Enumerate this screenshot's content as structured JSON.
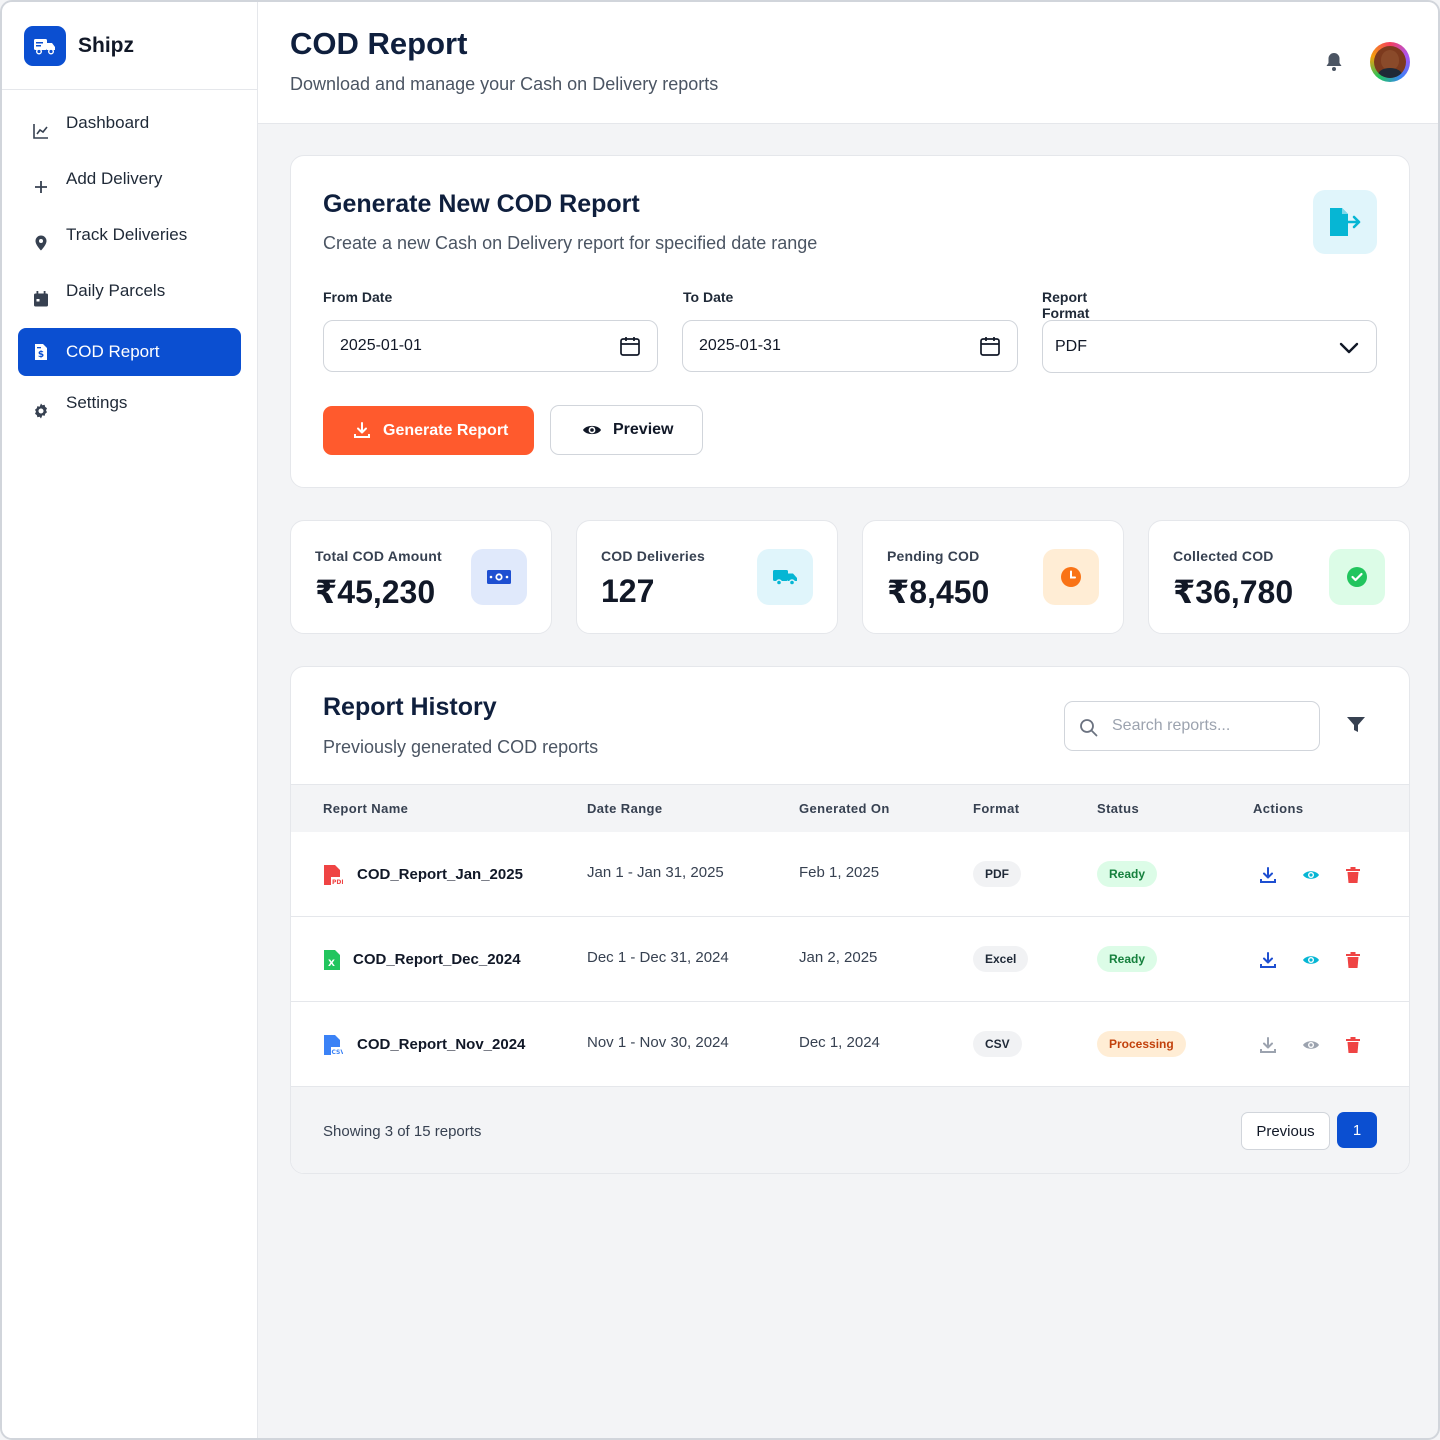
{
  "brand": {
    "name": "Shipz",
    "icon": "truck-icon"
  },
  "sidebar": {
    "items": [
      {
        "label": "Dashboard",
        "icon": "chart-line-icon"
      },
      {
        "label": "Add Delivery",
        "icon": "plus-icon"
      },
      {
        "label": "Track Deliveries",
        "icon": "location-pin-icon"
      },
      {
        "label": "Daily Parcels",
        "icon": "calendar-icon"
      },
      {
        "label": "COD Report",
        "icon": "invoice-icon",
        "active": true
      },
      {
        "label": "Settings",
        "icon": "gear-icon"
      }
    ]
  },
  "header": {
    "title": "COD Report",
    "subtitle": "Download and manage your Cash on Delivery reports"
  },
  "generate": {
    "title": "Generate New COD Report",
    "subtitle": "Create a new Cash on Delivery report for specified date range",
    "from_label": "From Date",
    "from_value": "2025-01-01",
    "to_label": "To Date",
    "to_value": "2025-01-31",
    "format_label_1": "Report",
    "format_label_2": "Format",
    "format_value": "PDF",
    "generate_button": "Generate Report",
    "preview_button": "Preview"
  },
  "stats": [
    {
      "label": "Total COD Amount",
      "value": "₹45,230",
      "icon": "money-icon",
      "color": "#1e4fd1",
      "bg": "#e0e9fb"
    },
    {
      "label": "COD Deliveries",
      "value": "127",
      "icon": "truck-icon",
      "color": "#06b6d4",
      "bg": "#e0f5fb"
    },
    {
      "label": "Pending COD",
      "value": "₹8,450",
      "icon": "clock-icon",
      "color": "#f97316",
      "bg": "#ffedd5"
    },
    {
      "label": "Collected COD",
      "value": "₹36,780",
      "icon": "check-circle-icon",
      "color": "#22c55e",
      "bg": "#dcfce7"
    }
  ],
  "history": {
    "title": "Report History",
    "subtitle": "Previously generated COD reports",
    "search_placeholder": "Search reports...",
    "columns": [
      "Report Name",
      "Date Range",
      "Generated On",
      "Format",
      "Status",
      "Actions"
    ],
    "rows": [
      {
        "name": "COD_Report_Jan_2025",
        "range": "Jan 1 - Jan 31, 2025",
        "generated": "Feb 1, 2025",
        "format": "PDF",
        "status": "Ready",
        "file_icon": "pdf-file-icon"
      },
      {
        "name": "COD_Report_Dec_2024",
        "range": "Dec 1 - Dec 31, 2024",
        "generated": "Jan 2, 2025",
        "format": "Excel",
        "status": "Ready",
        "file_icon": "excel-file-icon"
      },
      {
        "name": "COD_Report_Nov_2024",
        "range": "Nov 1 - Nov 30, 2024",
        "generated": "Dec 1, 2024",
        "format": "CSV",
        "status": "Processing",
        "file_icon": "csv-file-icon"
      }
    ],
    "footer_text": "Showing 3 of 15 reports",
    "prev_button": "Previous",
    "page_number": "1"
  }
}
